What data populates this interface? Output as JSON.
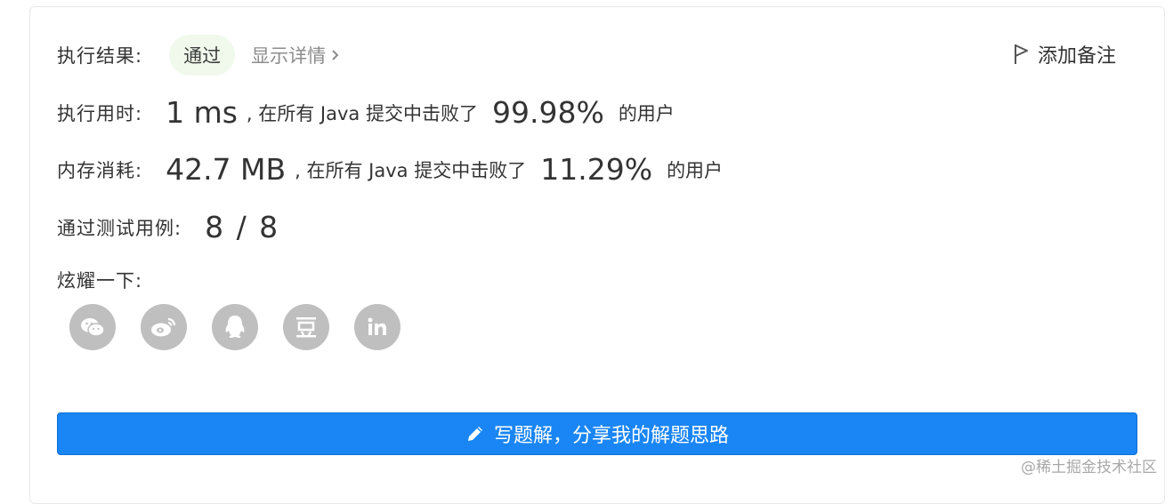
{
  "result": {
    "label": "执行结果:",
    "status": "通过",
    "details_link": "显示详情",
    "add_note": "添加备注"
  },
  "runtime": {
    "label": "执行用时:",
    "value": "1 ms",
    "mid_text": ", 在所有 Java 提交中击败了",
    "percent": "99.98%",
    "suffix": "的用户"
  },
  "memory": {
    "label": "内存消耗:",
    "value": "42.7 MB",
    "mid_text": ", 在所有 Java 提交中击败了",
    "percent": "11.29%",
    "suffix": "的用户"
  },
  "testcases": {
    "label": "通过测试用例:",
    "value": "8 / 8"
  },
  "share": {
    "label": "炫耀一下:",
    "icons": [
      "wechat-icon",
      "weibo-icon",
      "qq-icon",
      "douban-icon",
      "linkedin-icon"
    ]
  },
  "write_solution": {
    "label": "写题解，分享我的解题思路"
  },
  "watermark": "@稀土掘金技术社区",
  "colors": {
    "accent": "#1a86f5",
    "pass_badge_bg": "#f0f9ec",
    "social_icon_bg": "#bfbfbf"
  }
}
